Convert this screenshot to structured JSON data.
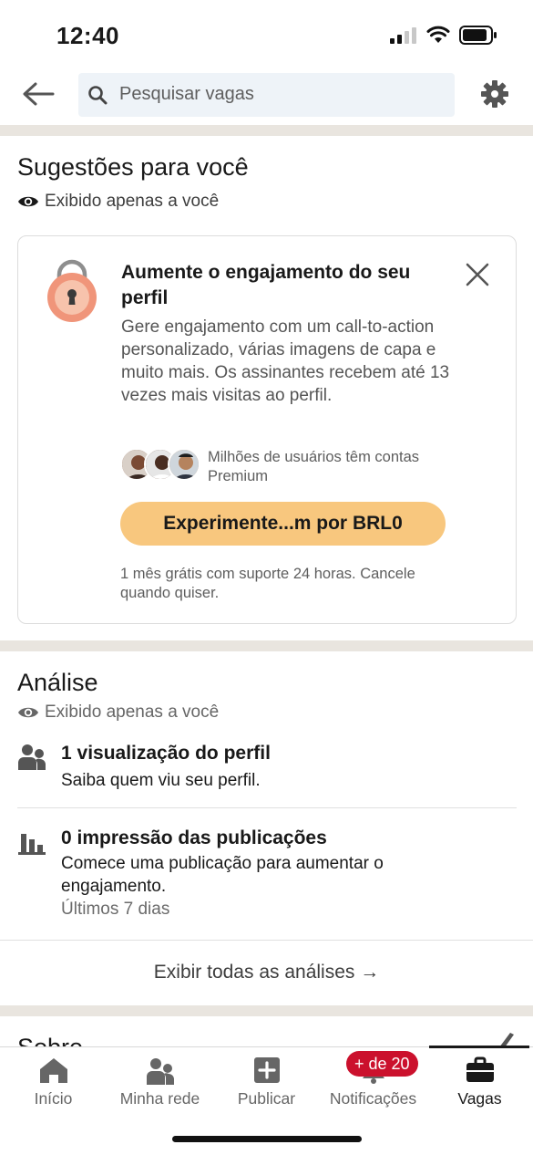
{
  "status_bar": {
    "time": "12:40"
  },
  "search": {
    "placeholder": "Pesquisar vagas"
  },
  "suggestions": {
    "title": "Sugestões para você",
    "visibility": "Exibido apenas a você",
    "promo": {
      "title": "Aumente o engajamento do seu perfil",
      "body": "Gere engajamento com um call-to-action personalizado, várias imagens de capa e muito mais. Os assinantes recebem até 13 vezes mais visitas ao perfil.",
      "social_proof": "Milhões de usuários têm contas Premium",
      "cta": "Experimente...m por BRL0",
      "fine_print": "1 mês grátis com suporte 24 horas. Cancele quando quiser."
    }
  },
  "analytics": {
    "title": "Análise",
    "visibility": "Exibido apenas a você",
    "items": [
      {
        "title": "1 visualização do perfil",
        "subtitle": "Saiba quem viu seu perfil.",
        "icon": "people-icon"
      },
      {
        "title": "0 impressão das publicações",
        "subtitle": "Comece uma publicação para aumentar o engajamento.",
        "meta": "Últimos 7 dias",
        "icon": "bar-chart-icon"
      }
    ],
    "show_all": "Exibir todas as análises →"
  },
  "next_section": {
    "title_partial": "Sobre"
  },
  "bottom_nav": {
    "items": [
      {
        "label": "Início",
        "icon": "home-icon"
      },
      {
        "label": "Minha rede",
        "icon": "network-icon"
      },
      {
        "label": "Publicar",
        "icon": "post-icon"
      },
      {
        "label": "Notificações",
        "icon": "bell-icon"
      },
      {
        "label": "Vagas",
        "icon": "briefcase-icon",
        "active": true
      }
    ],
    "notifications_badge": "+ de 20"
  },
  "colors": {
    "accent_premium": "#f8c77e",
    "badge_red": "#cb112d",
    "divider": "#e9e5df",
    "lock_orange": "#f0957a"
  }
}
